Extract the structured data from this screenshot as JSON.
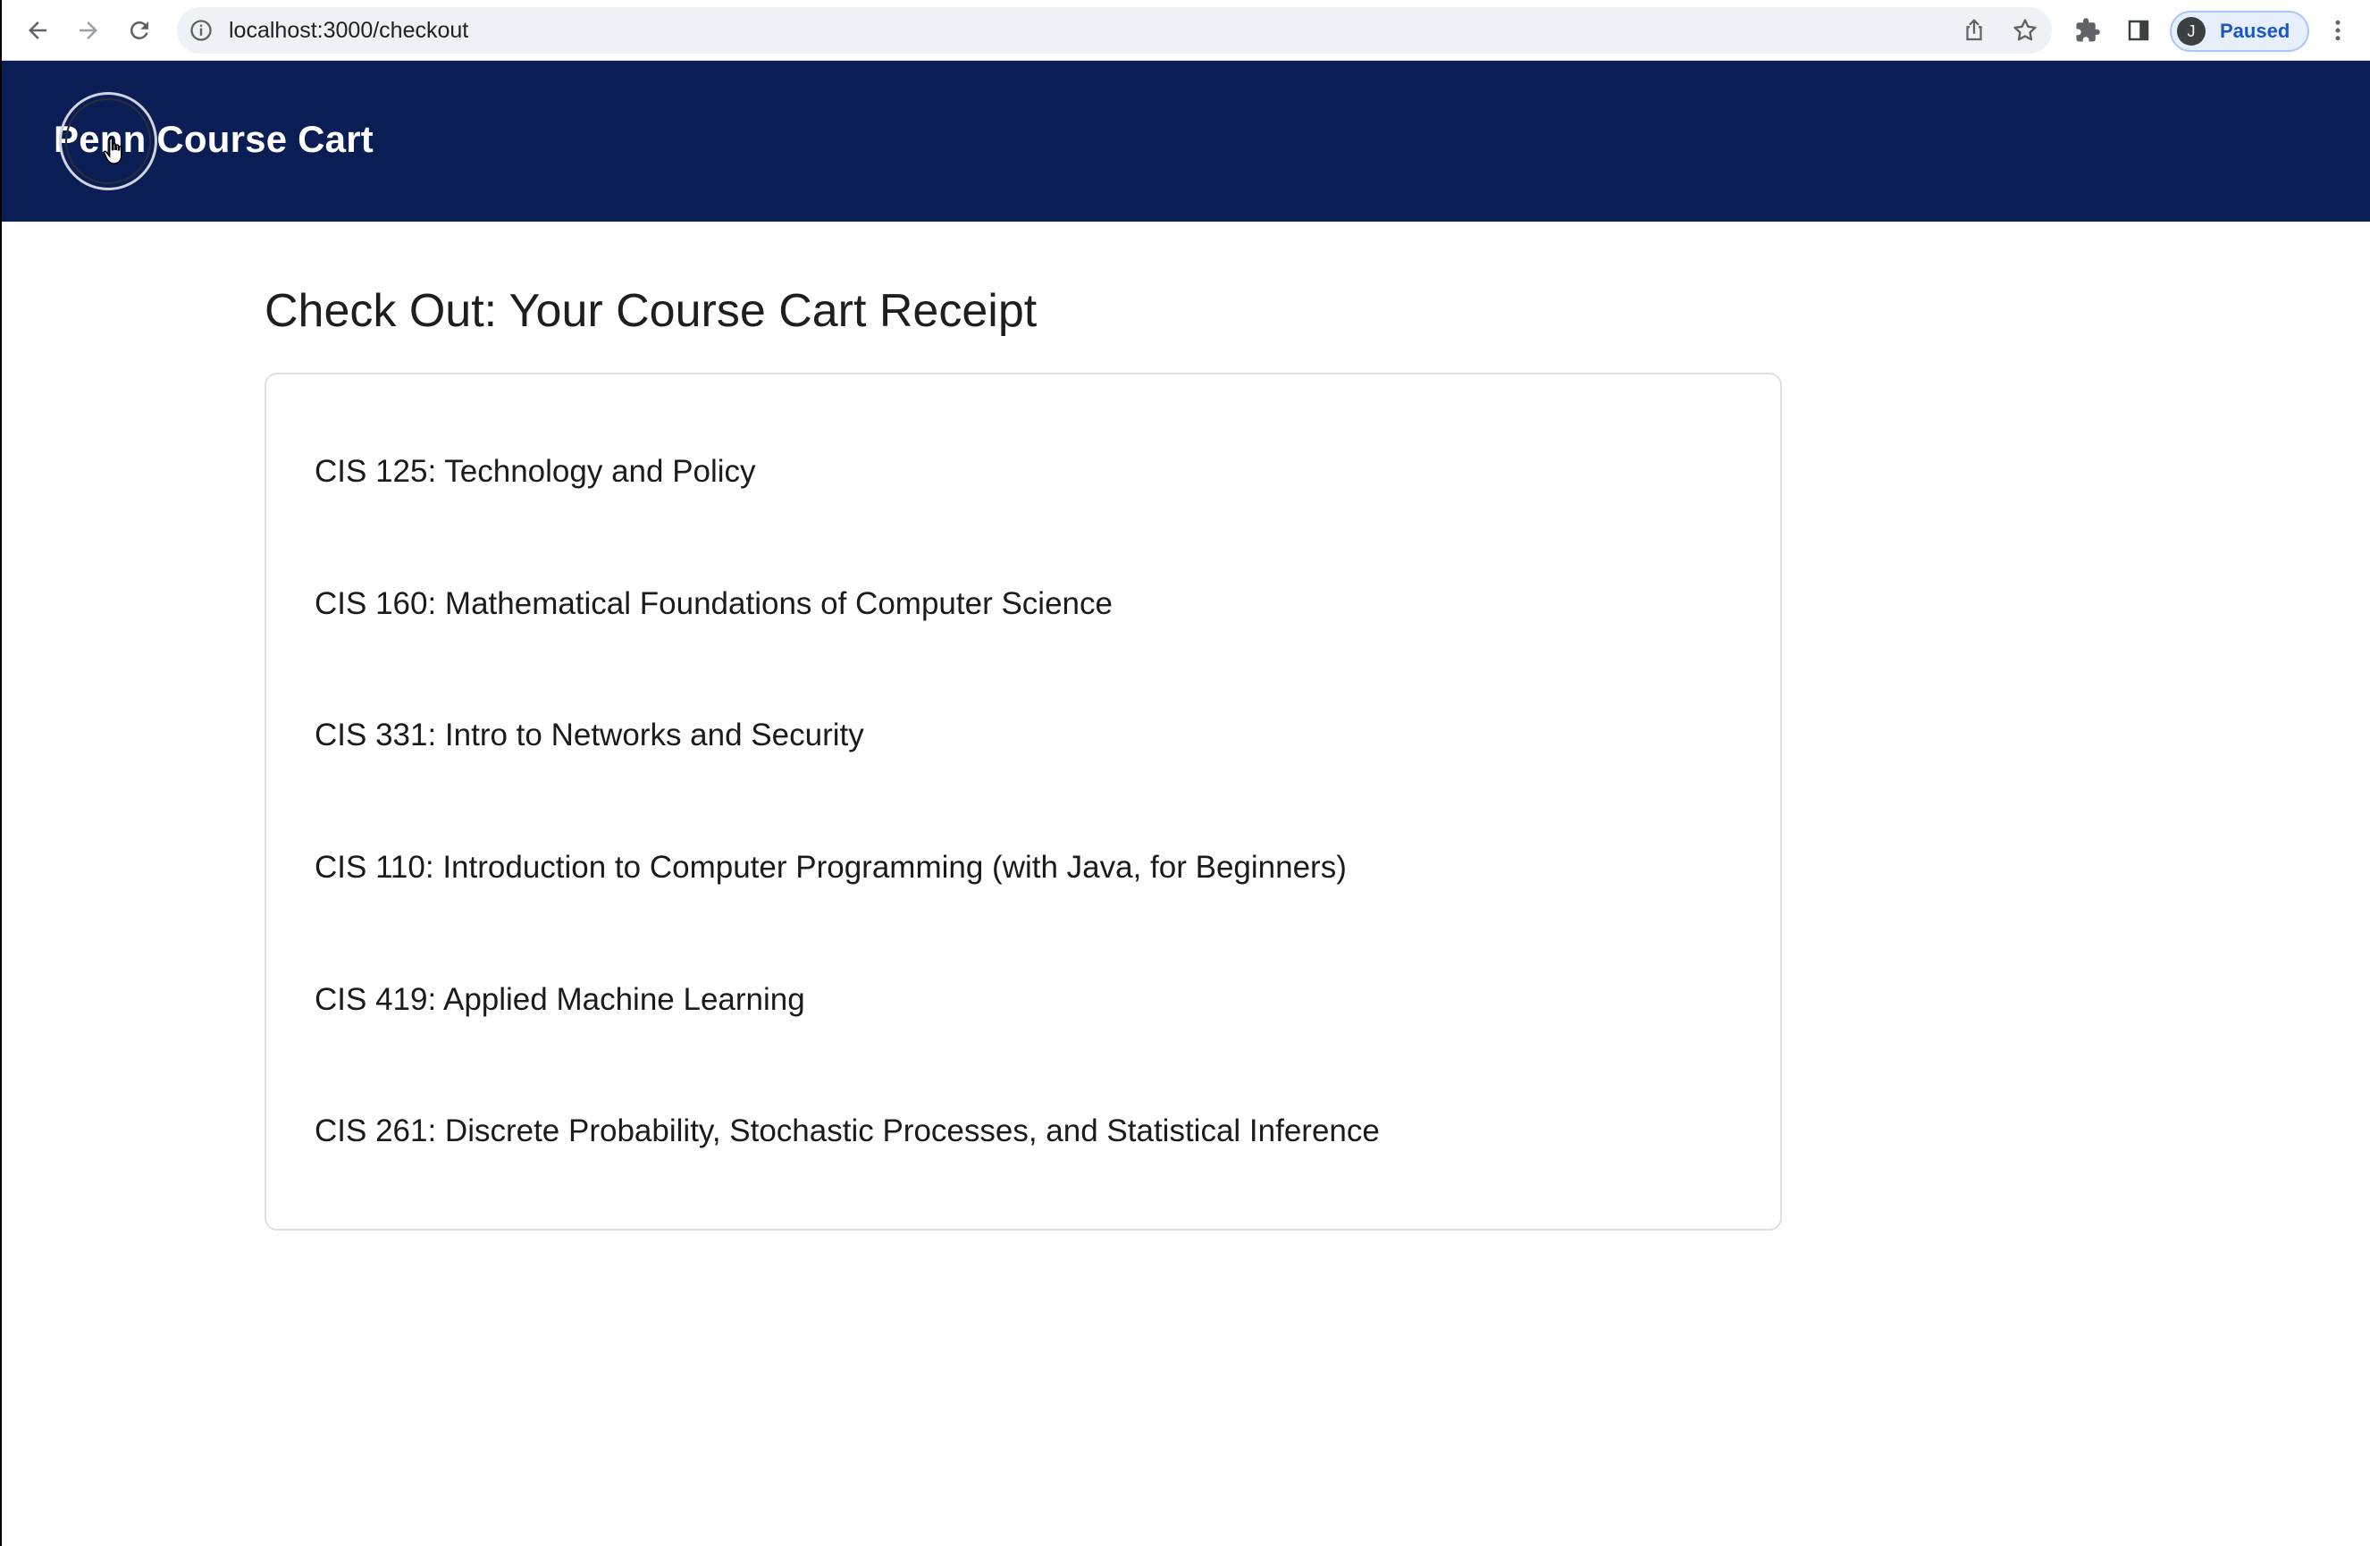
{
  "browser": {
    "url": "localhost:3000/checkout",
    "icons": [
      "back-icon",
      "forward-icon",
      "reload-icon",
      "info-icon",
      "share-icon",
      "star-icon",
      "extensions-icon",
      "side-panel-icon",
      "menu-icon"
    ],
    "profile": {
      "initial": "J",
      "status": "Paused"
    }
  },
  "header": {
    "brand": "Penn Course Cart",
    "background": "#0b1d55"
  },
  "main": {
    "title": "Check Out: Your Course Cart Receipt",
    "courses": [
      "CIS 125: Technology and Policy",
      "CIS 160: Mathematical Foundations of Computer Science",
      "CIS 331: Intro to Networks and Security",
      "CIS 110: Introduction to Computer Programming (with Java, for Beginners)",
      "CIS 419: Applied Machine Learning",
      "CIS 261: Discrete Probability, Stochastic Processes, and Statistical Inference"
    ]
  }
}
